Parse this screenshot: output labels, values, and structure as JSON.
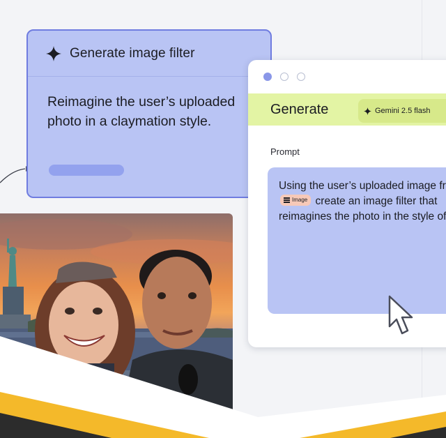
{
  "filter_card": {
    "icon": "sparkle-icon",
    "title": "Generate image filter",
    "description": "Reimagine the user’s uploaded photo in a claymation style."
  },
  "generate_card": {
    "title": "Generate",
    "model_chip": "Gemini 2.5 flash",
    "prompt_label": "Prompt",
    "prompt": {
      "text_before": "Using the user’s uploaded image from",
      "chip_label": "Image",
      "text_after": "create an image filter that reimagines the photo in the style of c"
    }
  },
  "colors": {
    "filter_card_bg": "#b9c4f4",
    "filter_card_border": "#6f7ce0",
    "generate_header_bg": "#e3f4a4",
    "model_chip_bg": "#d7e98a",
    "image_chip_bg": "#f7c9b8",
    "stripe_yellow": "#f4b92a",
    "stripe_dark": "#2c2c2c"
  }
}
